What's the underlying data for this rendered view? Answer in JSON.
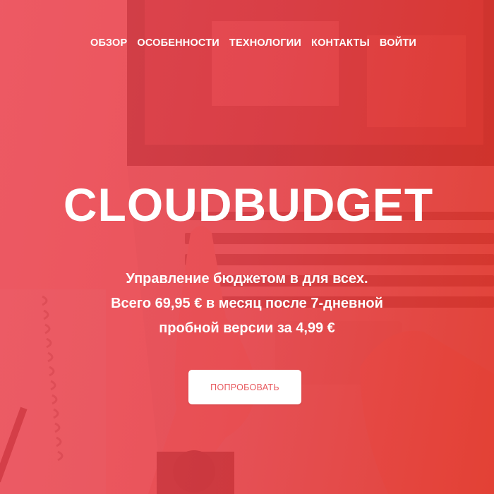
{
  "nav": {
    "items": [
      {
        "label": "ОБЗОР"
      },
      {
        "label": "ОСОБЕННОСТИ"
      },
      {
        "label": "ТЕХНОЛОГИИ"
      },
      {
        "label": "КОНТАКТЫ"
      },
      {
        "label": "ВОЙТИ"
      }
    ]
  },
  "hero": {
    "title": "CLOUDBUDGET",
    "subtitle_lines": [
      "Управление бюджетом в для всех.",
      "Всего 69,95 € в месяц после 7-дневной",
      "пробной версии за 4,99 €"
    ],
    "cta_label": "ПОПРОБОВАТЬ"
  },
  "colors": {
    "overlay": "#e8485a",
    "text": "#ffffff",
    "button_bg": "#ffffff",
    "button_text": "#e85a5f"
  },
  "background": {
    "description_icons": [
      "laptop-image",
      "keyboard-image",
      "hand-image",
      "notebook-image",
      "pen-image",
      "wristwatch-image"
    ]
  }
}
